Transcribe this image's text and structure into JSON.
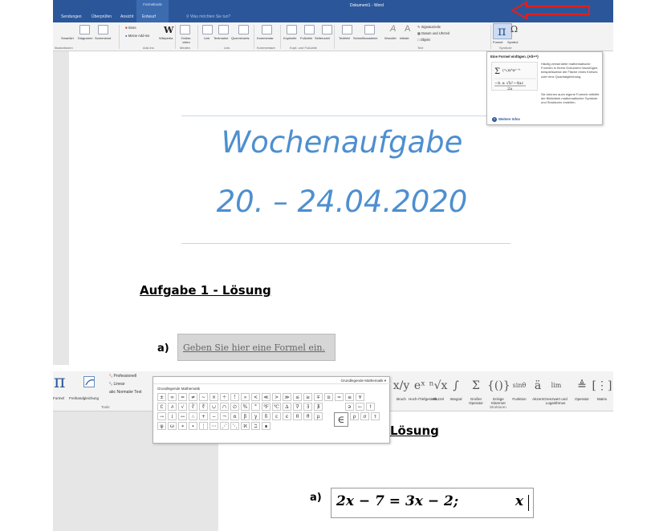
{
  "panel1": {
    "context_tab": {
      "header": "Formeltools",
      "label": "Entwurf"
    },
    "tabs": [
      "Sendungen",
      "Überprüfen",
      "Ansicht"
    ],
    "tell_me": "Was möchten Sie tun?",
    "doc_title": "Dokument1 - Word",
    "ribbon": {
      "buttons": [
        "SmartArt",
        "Diagramm",
        "Screenshot",
        "Wikipedia",
        "Online-video",
        "Link",
        "Textmarke",
        "Querverweis",
        "Kommentar",
        "Kopfzeile",
        "Fußzeile",
        "Seitenzahl",
        "Textfeld",
        "Schnellbausteine",
        "WordArt",
        "Initiale"
      ],
      "store": "Store",
      "my_addins": "Meine Add-ins",
      "text_group_items": [
        "Signaturzeile",
        "Datum und Uhrzeit",
        "Objekt"
      ],
      "formula": "Formel",
      "symbol": "Symbol",
      "groups": [
        "Illustrationen",
        "Add-Ins",
        "Medien",
        "Link",
        "Kommentare",
        "Kopf- und Fußzeile",
        "Text",
        "Symbole"
      ]
    },
    "tooltip": {
      "title": "Eine Formel einfügen. (Alt+=)",
      "desc1": "Häufig verwendete mathematische Formeln in Ihrem Dokument hinzufügen, beispielsweise die Fläche eines Kreises oder eine Quadratgleichung.",
      "desc2": "Sie können auch eigene Formeln mithilfe der Bibliothek mathematischer Symbole und Strukturen erstellen.",
      "more": "Weitere Infos"
    },
    "document": {
      "title_line1": "Wochenaufgabe",
      "title_line2": "20. – 24.04.2020",
      "heading": "Aufgabe 1 - Lösung",
      "item_label": "a)",
      "placeholder": "Geben Sie hier eine Formel ein."
    }
  },
  "panel2": {
    "formula": "Formel",
    "ink_formula": "Freihandgleichung",
    "options": [
      "Professionell",
      "Linear",
      "Normaler Text"
    ],
    "tools_group": "Tools",
    "symbols_header": "Grundlegende Mathematik",
    "symbols_subheader": "Grundlegende Mathematik",
    "structures": [
      "Bruch",
      "Hoch-/Tiefgestellt",
      "Wurzel",
      "Integral",
      "Großer Operator",
      "Eckige Klammer",
      "Funktion",
      "Akzent",
      "Grenzwert und Logarithmus",
      "Operator",
      "Matrix"
    ],
    "structures_group": "Strukturen",
    "heading": "Lösung",
    "item_label": "a)",
    "equation": "2x − 7 = 3x − 2;",
    "equation_tail": "x"
  }
}
